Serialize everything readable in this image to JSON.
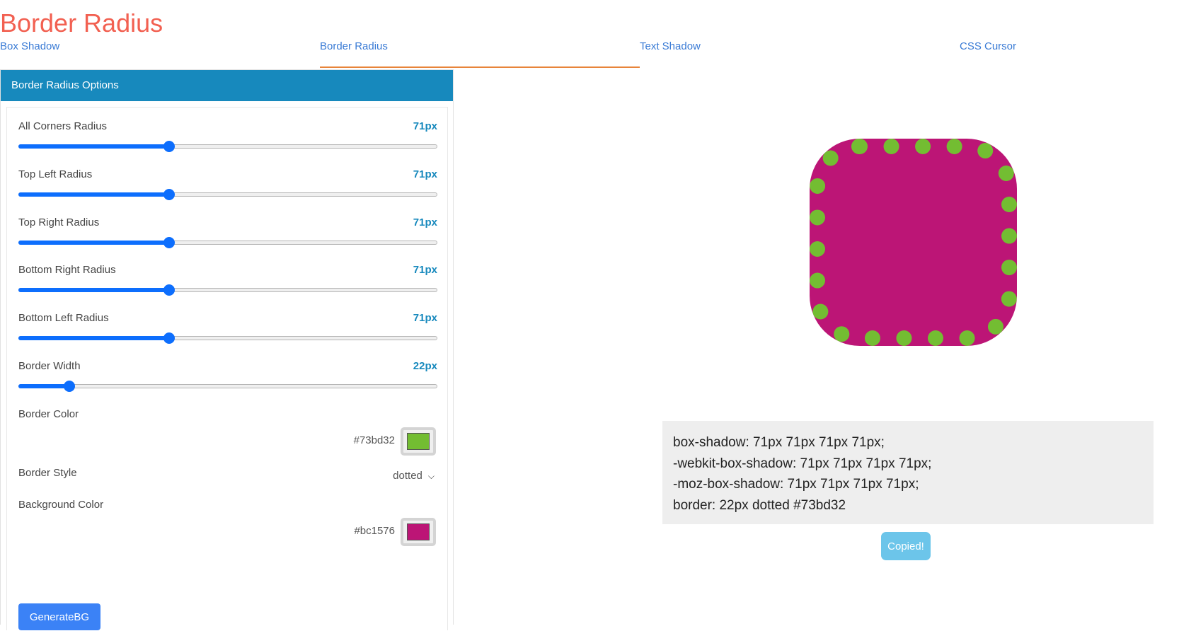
{
  "page": {
    "title": "Border Radius"
  },
  "tabs": [
    {
      "label": "Box Shadow",
      "active": false
    },
    {
      "label": "Border Radius",
      "active": true
    },
    {
      "label": "Text Shadow",
      "active": false
    },
    {
      "label": "CSS Cursor",
      "active": false
    }
  ],
  "options": {
    "header": "Border Radius Options",
    "sliders": [
      {
        "label": "All Corners Radius",
        "value_text": "71px",
        "fill_percent": 36
      },
      {
        "label": "Top Left Radius",
        "value_text": "71px",
        "fill_percent": 36
      },
      {
        "label": "Top Right Radius",
        "value_text": "71px",
        "fill_percent": 36
      },
      {
        "label": "Bottom Right Radius",
        "value_text": "71px",
        "fill_percent": 36
      },
      {
        "label": "Bottom Left Radius",
        "value_text": "71px",
        "fill_percent": 36
      },
      {
        "label": "Border Width",
        "value_text": "22px",
        "fill_percent": 12
      }
    ],
    "border_color": {
      "label": "Border Color",
      "hex": "#73bd32"
    },
    "border_style": {
      "label": "Border Style",
      "selected": "dotted"
    },
    "background_color": {
      "label": "Background Color",
      "hex": "#bc1576"
    },
    "generate_label": "GenerateBG"
  },
  "preview": {
    "border_color": "#73bd32",
    "background_color": "#bc1576",
    "border_style": "dotted"
  },
  "code": {
    "lines": [
      "box-shadow: 71px 71px 71px 71px;",
      "-webkit-box-shadow: 71px 71px 71px 71px;",
      "-moz-box-shadow: 71px 71px 71px 71px;",
      "border: 22px dotted #73bd32"
    ],
    "copy_label": "Copied!"
  },
  "colors": {
    "title": "#f26051",
    "tab_link": "#3a7bd5",
    "tab_active_underline": "#e8843a",
    "panel_header": "#1789bd",
    "slider_accent": "#0d6efd",
    "generate_button": "#3b82f6",
    "copied_button": "#6cc5ea"
  }
}
